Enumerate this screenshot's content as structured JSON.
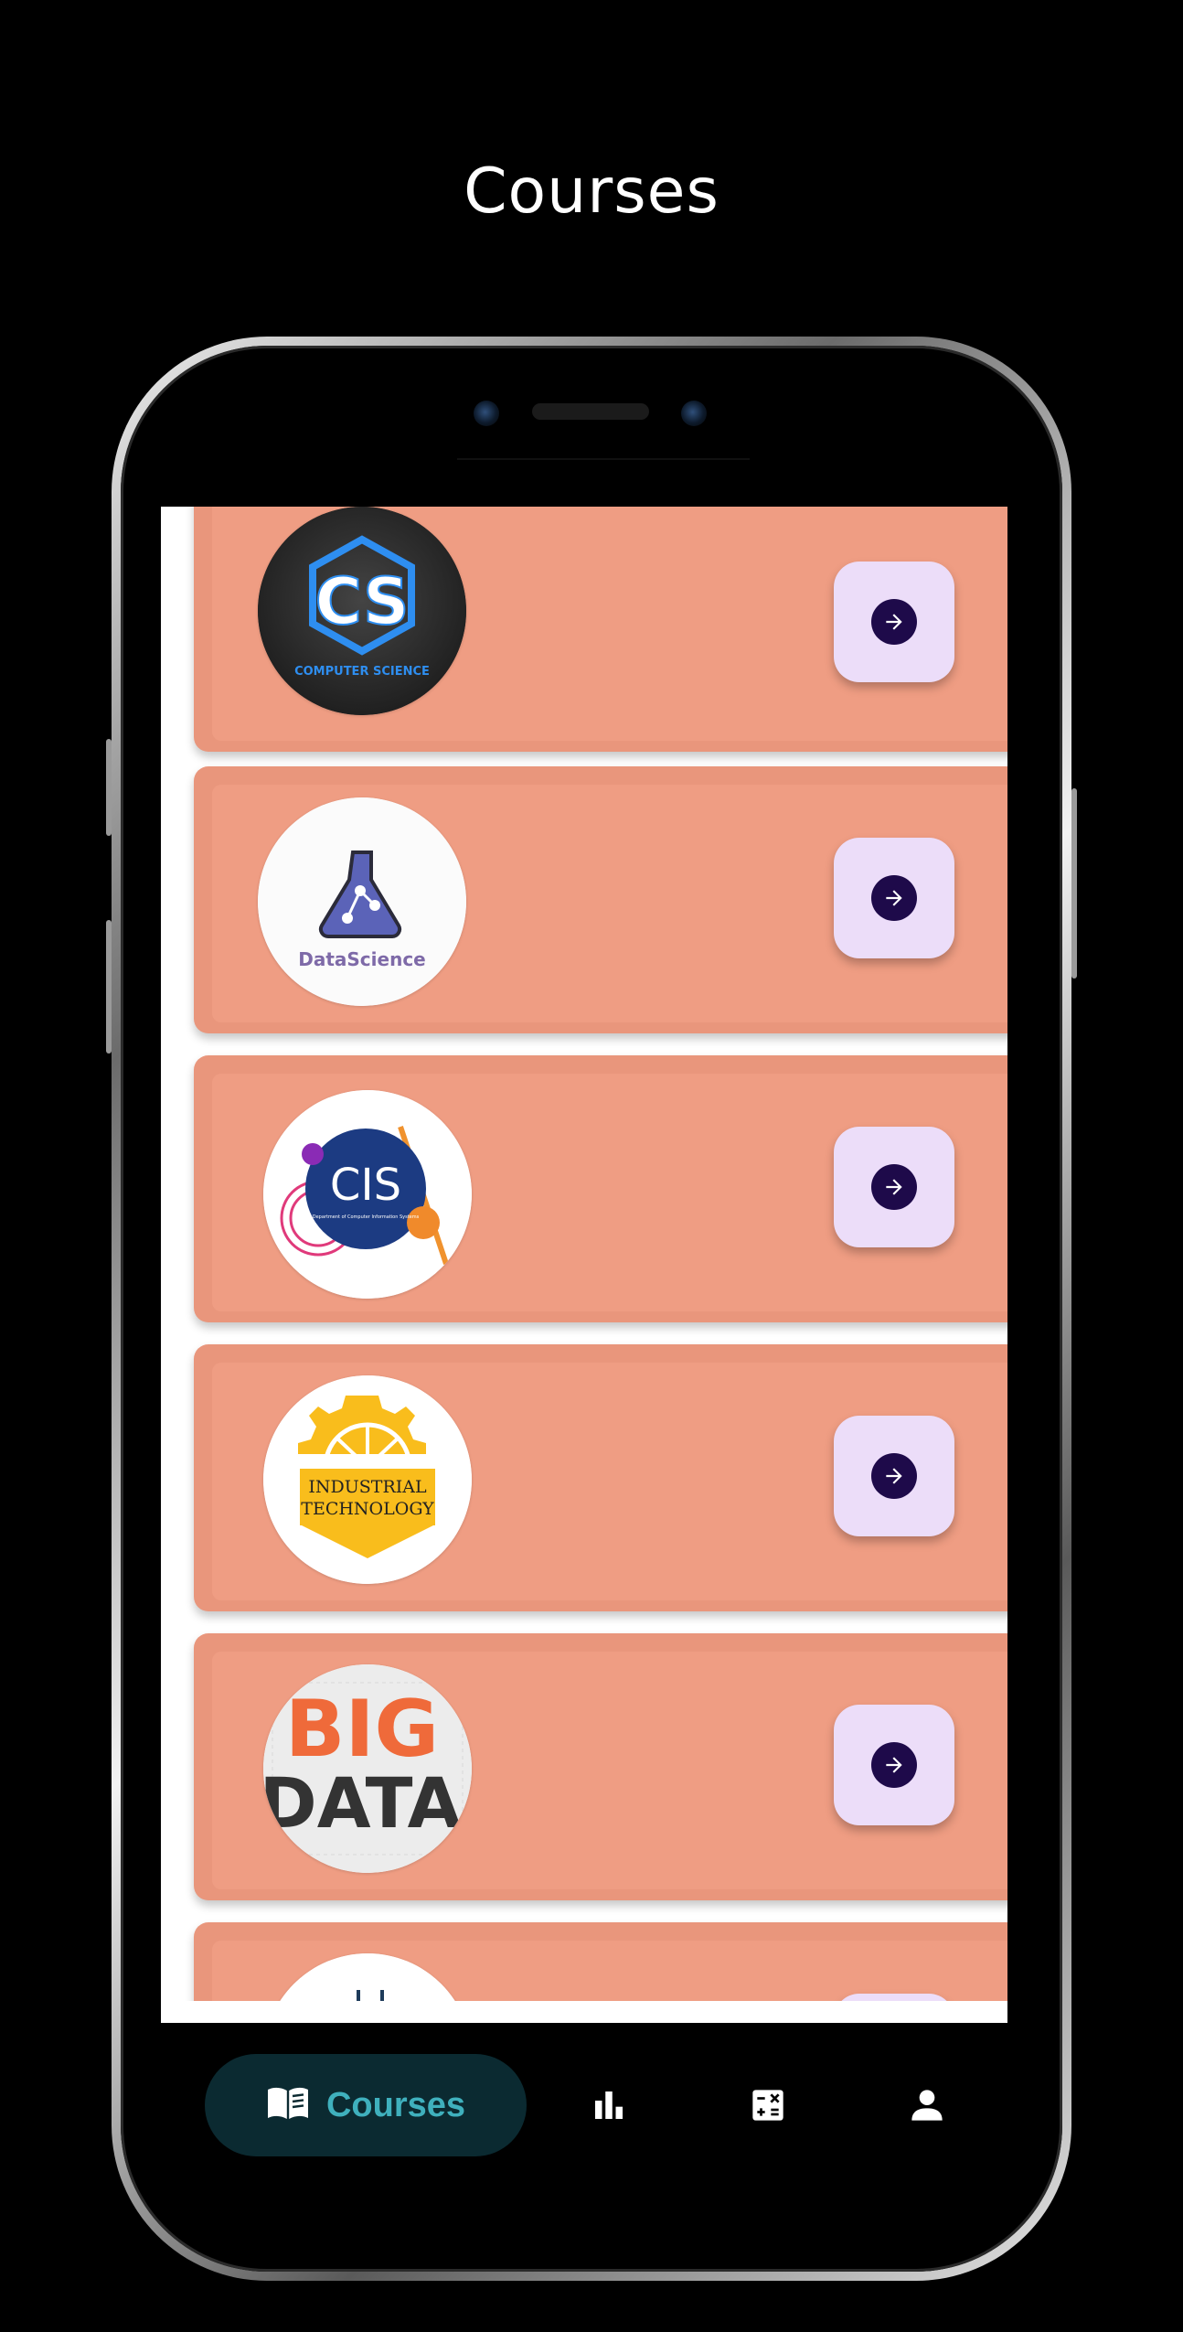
{
  "header": {
    "title": "Courses"
  },
  "courses": [
    {
      "logo": "computer-science-logo",
      "logo_text": "COMPUTER SCIENCE",
      "logo_mark": "CS",
      "action_icon": "arrow-right-icon"
    },
    {
      "logo": "data-science-logo",
      "logo_text": "DataScience",
      "action_icon": "arrow-right-icon"
    },
    {
      "logo": "cis-logo",
      "logo_text": "CIS",
      "logo_subtext": "Department of Computer Information Systems",
      "action_icon": "arrow-right-icon"
    },
    {
      "logo": "industrial-technology-logo",
      "logo_text_line1": "INDUSTRIAL",
      "logo_text_line2": "TECHNOLOGY",
      "action_icon": "arrow-right-icon"
    },
    {
      "logo": "big-data-logo",
      "logo_text_line1": "BIG",
      "logo_text_line2": "DATA",
      "action_icon": "arrow-right-icon"
    },
    {
      "logo": "partial-course-logo",
      "action_icon": "arrow-right-icon"
    }
  ],
  "bottom_nav": {
    "active_label": "Courses",
    "items": [
      {
        "name": "courses",
        "icon": "book-icon"
      },
      {
        "name": "stats",
        "icon": "bar-chart-icon"
      },
      {
        "name": "calculator",
        "icon": "calculator-icon"
      },
      {
        "name": "profile",
        "icon": "person-icon"
      }
    ]
  },
  "colors": {
    "background": "#000000",
    "card": "#e9967c",
    "card_inset": "#ef9d83",
    "action_button": "#ecddf9",
    "action_icon": "#1e0a4a",
    "nav_pill": "#0b2a31",
    "nav_accent": "#3fb0bd"
  }
}
